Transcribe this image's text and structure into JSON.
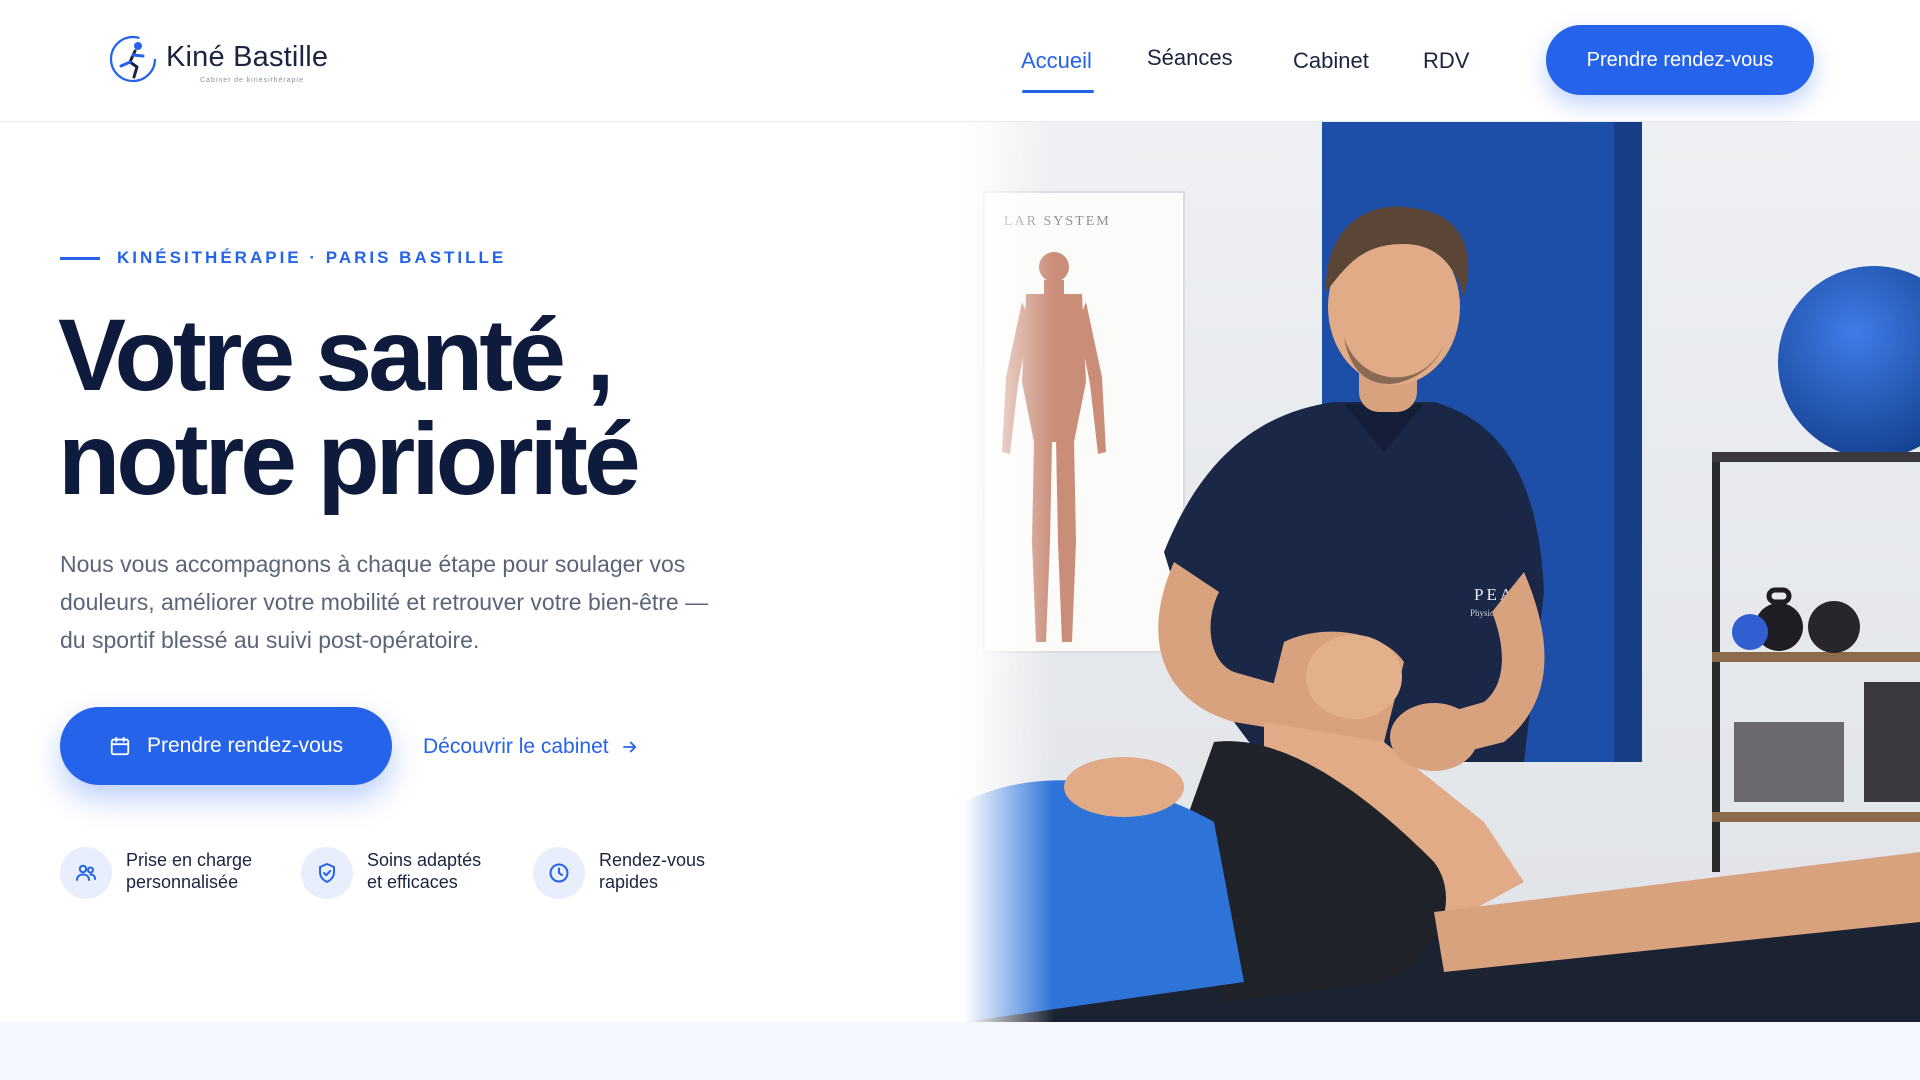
{
  "header": {
    "logo": {
      "name": "Kiné Bastille",
      "tagline": "Cabinet de kinésithérapie"
    },
    "nav": [
      {
        "label": "Accueil",
        "active": true
      },
      {
        "label": "Séances",
        "active": false
      },
      {
        "label": "Cabinet",
        "active": false
      },
      {
        "label": "RDV",
        "active": false
      }
    ],
    "cta_label": "Prendre rendez-vous"
  },
  "hero": {
    "eyebrow": "KINÉSITHÉRAPIE · PARIS BASTILLE",
    "title_line1": "Votre santé ,",
    "title_line2": "notre priorité",
    "description": "Nous vous accompagnons à chaque étape pour soulager vos douleurs, améliorer votre mobilité et retrouver votre bien-être — du sportif blessé au suivi post-opératoire.",
    "primary_cta": "Prendre rendez-vous",
    "secondary_cta": "Découvrir le cabinet",
    "features": [
      {
        "icon": "users-icon",
        "line1": "Prise en charge",
        "line2": "personnalisée"
      },
      {
        "icon": "shield-check-icon",
        "line1": "Soins adaptés",
        "line2": "et efficaces"
      },
      {
        "icon": "clock-icon",
        "line1": "Rendez-vous",
        "line2": "rapides"
      }
    ],
    "image": {
      "poster_text": "LAR SYSTEM",
      "shirt_brand": "PEAK",
      "shirt_subtitle": "Physiotherapy"
    }
  },
  "colors": {
    "accent": "#2563eb",
    "heading": "#0f1b3d",
    "body_text": "#5b6478",
    "icon_bg": "#e8eefc"
  }
}
